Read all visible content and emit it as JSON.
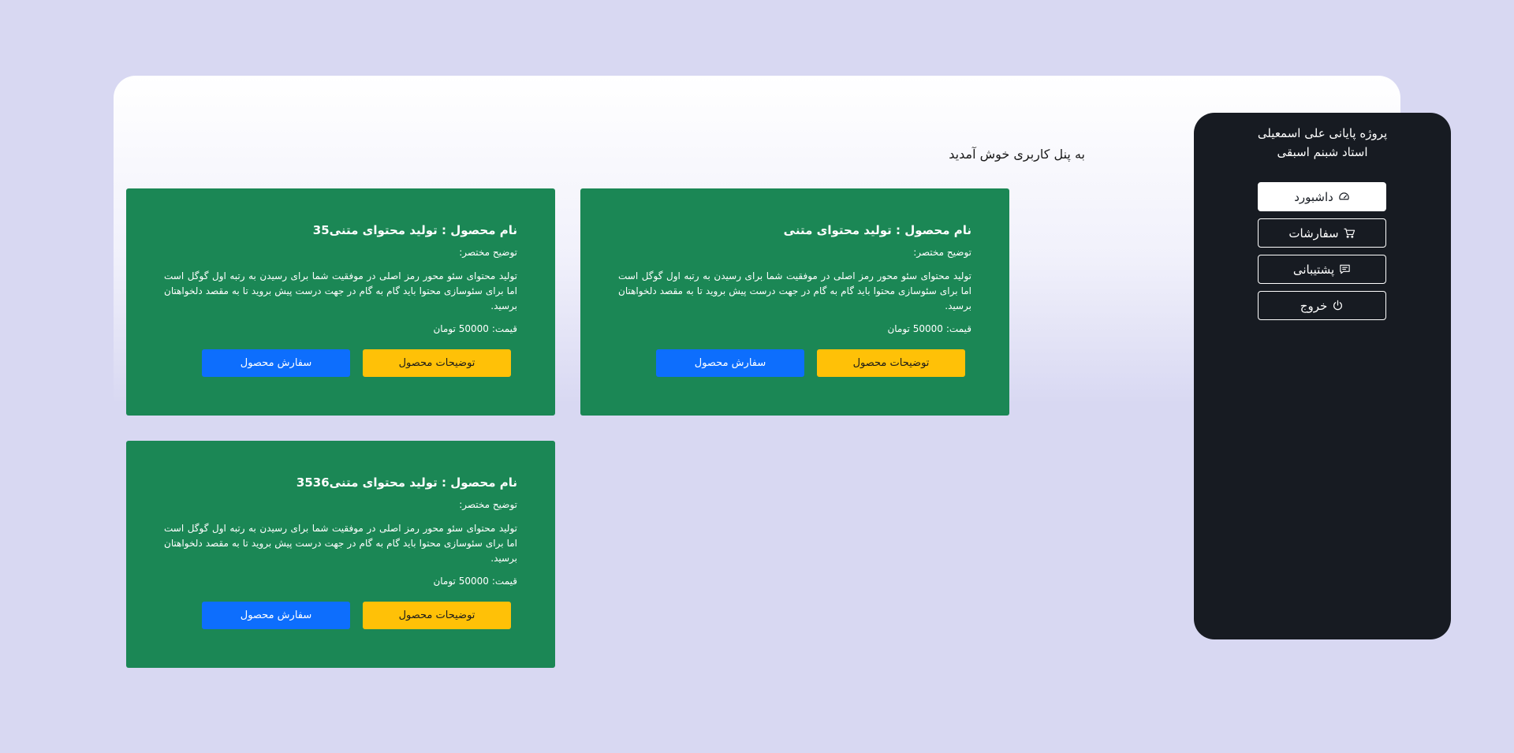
{
  "welcome": "به پنل کاربری خوش آمدید",
  "sidebar": {
    "line1": "پروژه پایانی علی اسمعیلی",
    "line2": "استاد شبنم اسبقی",
    "items": [
      {
        "label": "داشبورد",
        "icon": "dashboard-icon",
        "active": true
      },
      {
        "label": "سفارشات",
        "icon": "cart-icon",
        "active": false
      },
      {
        "label": "پشتیبانی",
        "icon": "chat-icon",
        "active": false
      },
      {
        "label": "خروج",
        "icon": "power-icon",
        "active": false
      }
    ]
  },
  "cards": [
    {
      "title": "نام محصول : تولید محتوای متنی",
      "subtitle": "توضیح مختصر:",
      "description": "تولید محتوای سئو محور رمز اصلی در موفقیت شما برای رسیدن به رتبه اول گوگل است اما برای سئوسازی محتوا باید گام به گام در جهت درست پیش بروید تا به مقصد دلخواهتان برسید.",
      "price_label": "قیمت:",
      "price_value": "50000 تومان",
      "details_button": "توضیحات محصول",
      "order_button": "سفارش محصول"
    },
    {
      "title": "نام محصول : تولید محتوای متنی35",
      "subtitle": "توضیح مختصر:",
      "description": "تولید محتوای سئو محور رمز اصلی در موفقیت شما برای رسیدن به رتبه اول گوگل است اما برای سئوسازی محتوا باید گام به گام در جهت درست پیش بروید تا به مقصد دلخواهتان برسید.",
      "price_label": "قیمت:",
      "price_value": "50000 تومان",
      "details_button": "توضیحات محصول",
      "order_button": "سفارش محصول"
    },
    {
      "title": "نام محصول : تولید محتوای متنی3536",
      "subtitle": "توضیح مختصر:",
      "description": "تولید محتوای سئو محور رمز اصلی در موفقیت شما برای رسیدن به رتبه اول گوگل است اما برای سئوسازی محتوا باید گام به گام در جهت درست پیش بروید تا به مقصد دلخواهتان برسید.",
      "price_label": "قیمت:",
      "price_value": "50000 تومان",
      "details_button": "توضیحات محصول",
      "order_button": "سفارش محصول"
    }
  ],
  "colors": {
    "background": "#d8d8f2",
    "card": "#1b8755",
    "sidebar": "#171b22",
    "details_button": "#ffc107",
    "order_button": "#0d6efd"
  }
}
